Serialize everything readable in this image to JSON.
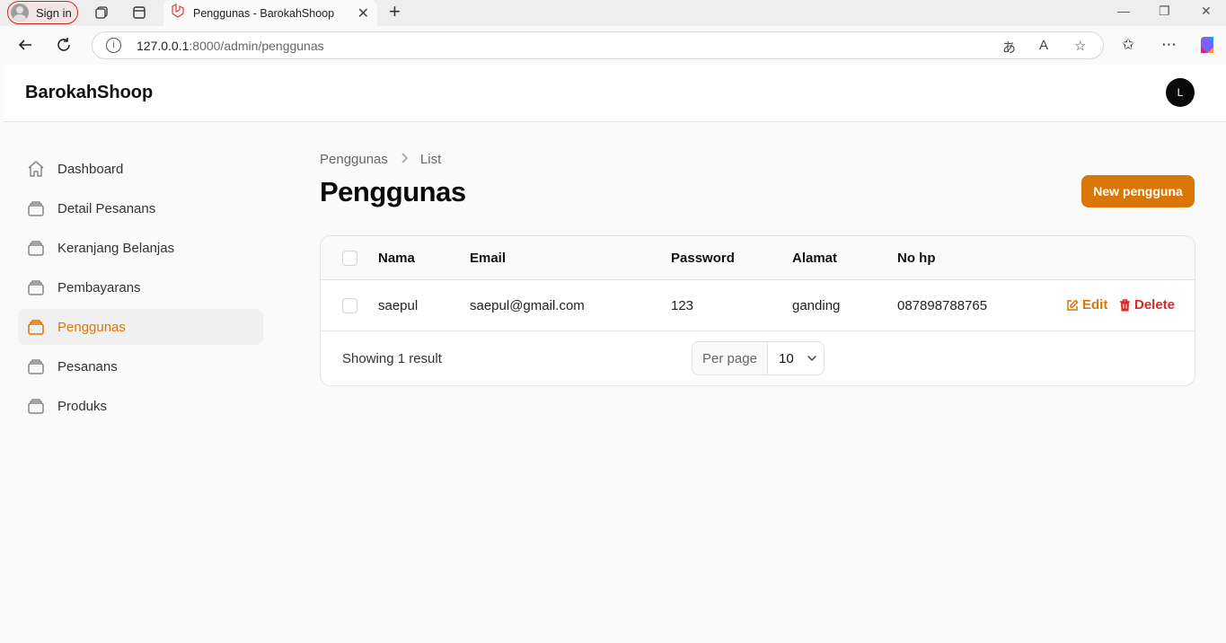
{
  "browser": {
    "signin_label": "Sign in",
    "tab_title": "Penggunas - BarokahShoop",
    "url_host": "127.0.0.1",
    "url_rest": ":8000/admin/penggunas"
  },
  "app": {
    "brand": "BarokahShoop",
    "user_initial": "L"
  },
  "sidebar": {
    "items": [
      {
        "label": "Dashboard",
        "icon": "home-icon",
        "active": false
      },
      {
        "label": "Detail Pesanans",
        "icon": "stack-icon",
        "active": false
      },
      {
        "label": "Keranjang Belanjas",
        "icon": "stack-icon",
        "active": false
      },
      {
        "label": "Pembayarans",
        "icon": "stack-icon",
        "active": false
      },
      {
        "label": "Penggunas",
        "icon": "stack-icon",
        "active": true
      },
      {
        "label": "Pesanans",
        "icon": "stack-icon",
        "active": false
      },
      {
        "label": "Produks",
        "icon": "stack-icon",
        "active": false
      }
    ]
  },
  "main": {
    "breadcrumb": [
      "Penggunas",
      "List"
    ],
    "title": "Penggunas",
    "new_button": "New pengguna",
    "table": {
      "columns": [
        "Nama",
        "Email",
        "Password",
        "Alamat",
        "No hp"
      ],
      "rows": [
        {
          "nama": "saepul",
          "email": "saepul@gmail.com",
          "password": "123",
          "alamat": "ganding",
          "no_hp": "087898788765"
        }
      ],
      "edit_label": "Edit",
      "delete_label": "Delete"
    },
    "footer": {
      "showing": "Showing 1 result",
      "per_page_label": "Per page",
      "per_page_value": "10"
    }
  },
  "colors": {
    "accent": "#d97706",
    "danger": "#dc2626"
  }
}
